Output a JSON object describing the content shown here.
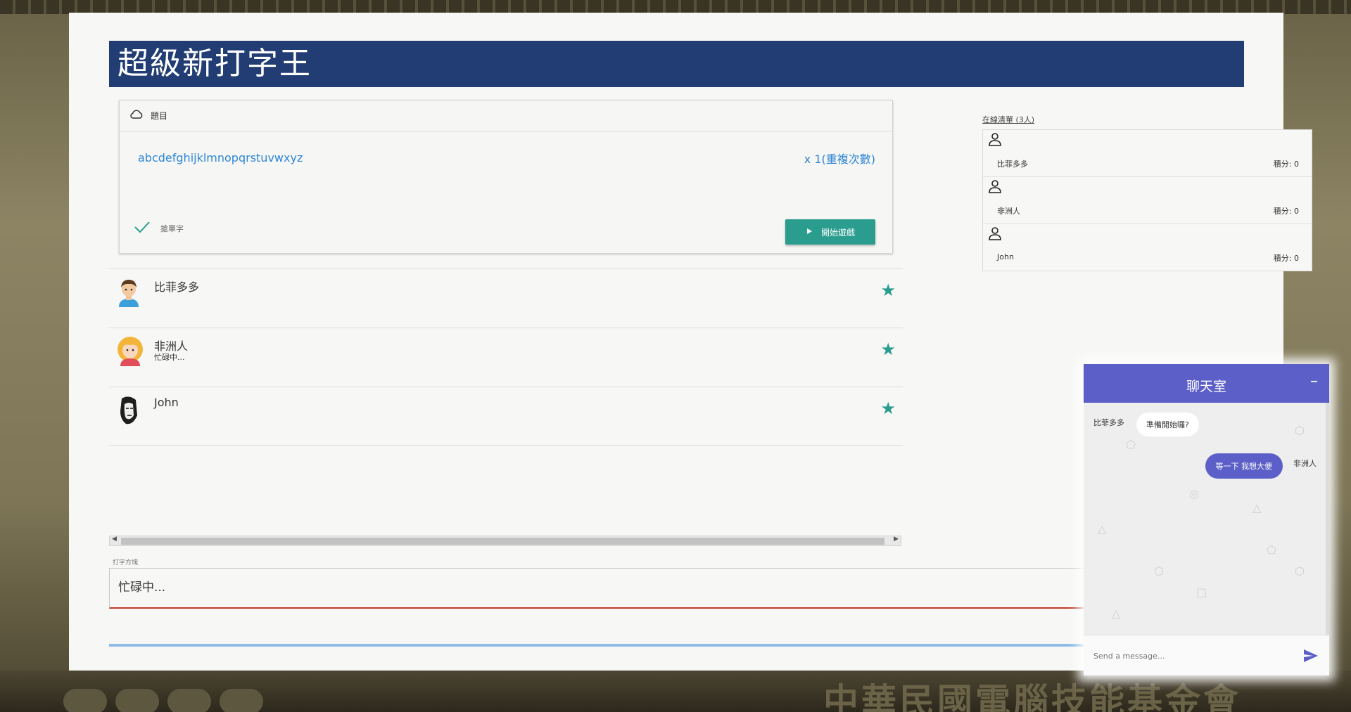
{
  "app": {
    "title": "超級新打字王"
  },
  "background": {
    "bottom_text": "中華民國電腦技能基金會"
  },
  "topic": {
    "header_label": "題目",
    "text": "abcdefghijklmnopqrstuvwxyz",
    "repeat": "x 1(重複次數)",
    "mode_label": "搶單字",
    "start_button": "開始遊戲"
  },
  "players": [
    {
      "name": "比菲多多",
      "status": ""
    },
    {
      "name": "非洲人",
      "status": "忙碌中..."
    },
    {
      "name": "John",
      "status": ""
    }
  ],
  "online": {
    "label": "在線清單 (3人)",
    "users": [
      {
        "name": "比菲多多",
        "score": "積分: 0"
      },
      {
        "name": "非洲人",
        "score": "積分: 0"
      },
      {
        "name": "John",
        "score": "積分: 0"
      }
    ]
  },
  "typing": {
    "label": "打字方塊",
    "value": "忙碌中..."
  },
  "chat": {
    "title": "聊天室",
    "minimize": "–",
    "messages": [
      {
        "sender": "比菲多多",
        "text": "準備開始囉?",
        "side": "left"
      },
      {
        "sender": "非洲人",
        "text": "等一下 我想大便",
        "side": "right"
      }
    ],
    "placeholder": "Send a message..."
  },
  "colors": {
    "title_bar": "#223d73",
    "accent": "#2a9d8f",
    "chat_accent": "#5b5fc7",
    "link": "#2e86d6"
  }
}
